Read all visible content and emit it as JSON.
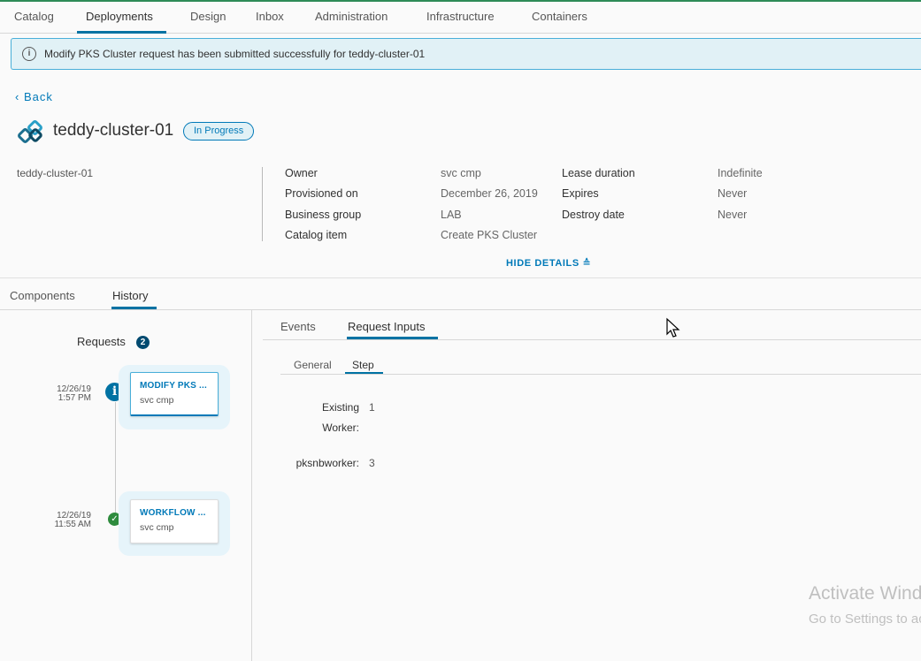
{
  "nav": {
    "tabs": [
      "Catalog",
      "Deployments",
      "Design",
      "Inbox",
      "Administration",
      "Infrastructure",
      "Containers"
    ],
    "active": "Deployments"
  },
  "alert": {
    "icon": "info-icon",
    "text": "Modify PKS Cluster request has been submitted successfully for teddy-cluster-01"
  },
  "back_label": "Back",
  "deployment": {
    "name": "teddy-cluster-01",
    "status": "In Progress",
    "left_name": "teddy-cluster-01"
  },
  "details": {
    "owner_label": "Owner",
    "owner_value": "svc cmp",
    "provisioned_label": "Provisioned on",
    "provisioned_value": "December 26, 2019",
    "business_group_label": "Business group",
    "business_group_value": "LAB",
    "catalog_item_label": "Catalog item",
    "catalog_item_value": "Create PKS Cluster",
    "lease_label": "Lease duration",
    "lease_value": "Indefinite",
    "expires_label": "Expires",
    "expires_value": "Never",
    "destroy_label": "Destroy date",
    "destroy_value": "Never",
    "hide_details": "HIDE DETAILS"
  },
  "section_tabs": {
    "components": "Components",
    "history": "History",
    "active": "History"
  },
  "requests": {
    "title": "Requests",
    "count": "2",
    "items": [
      {
        "date": "12/26/19",
        "time": "1:57 PM",
        "title": "MODIFY PKS ...",
        "owner": "svc cmp",
        "status": "info"
      },
      {
        "date": "12/26/19",
        "time": "11:55 AM",
        "title": "WORKFLOW ...",
        "owner": "svc cmp",
        "status": "success"
      }
    ]
  },
  "detail_tabs": {
    "events": "Events",
    "request_inputs": "Request Inputs",
    "active": "Request Inputs"
  },
  "input_tabs": {
    "general": "General",
    "step": "Step",
    "active": "Step"
  },
  "fields": {
    "existing_worker_label_line1": "Existing",
    "existing_worker_label_line2": "Worker:",
    "existing_worker_value": "1",
    "pksnbworker_label": "pksnbworker:",
    "pksnbworker_value": "3"
  },
  "watermark": {
    "line1": "Activate Windows",
    "line2": "Go to Settings to activate Windows."
  },
  "colors": {
    "accent": "#0072a3",
    "link": "#0079b8",
    "alert_bg": "#e1f1f6",
    "success": "#2e8b3d"
  }
}
